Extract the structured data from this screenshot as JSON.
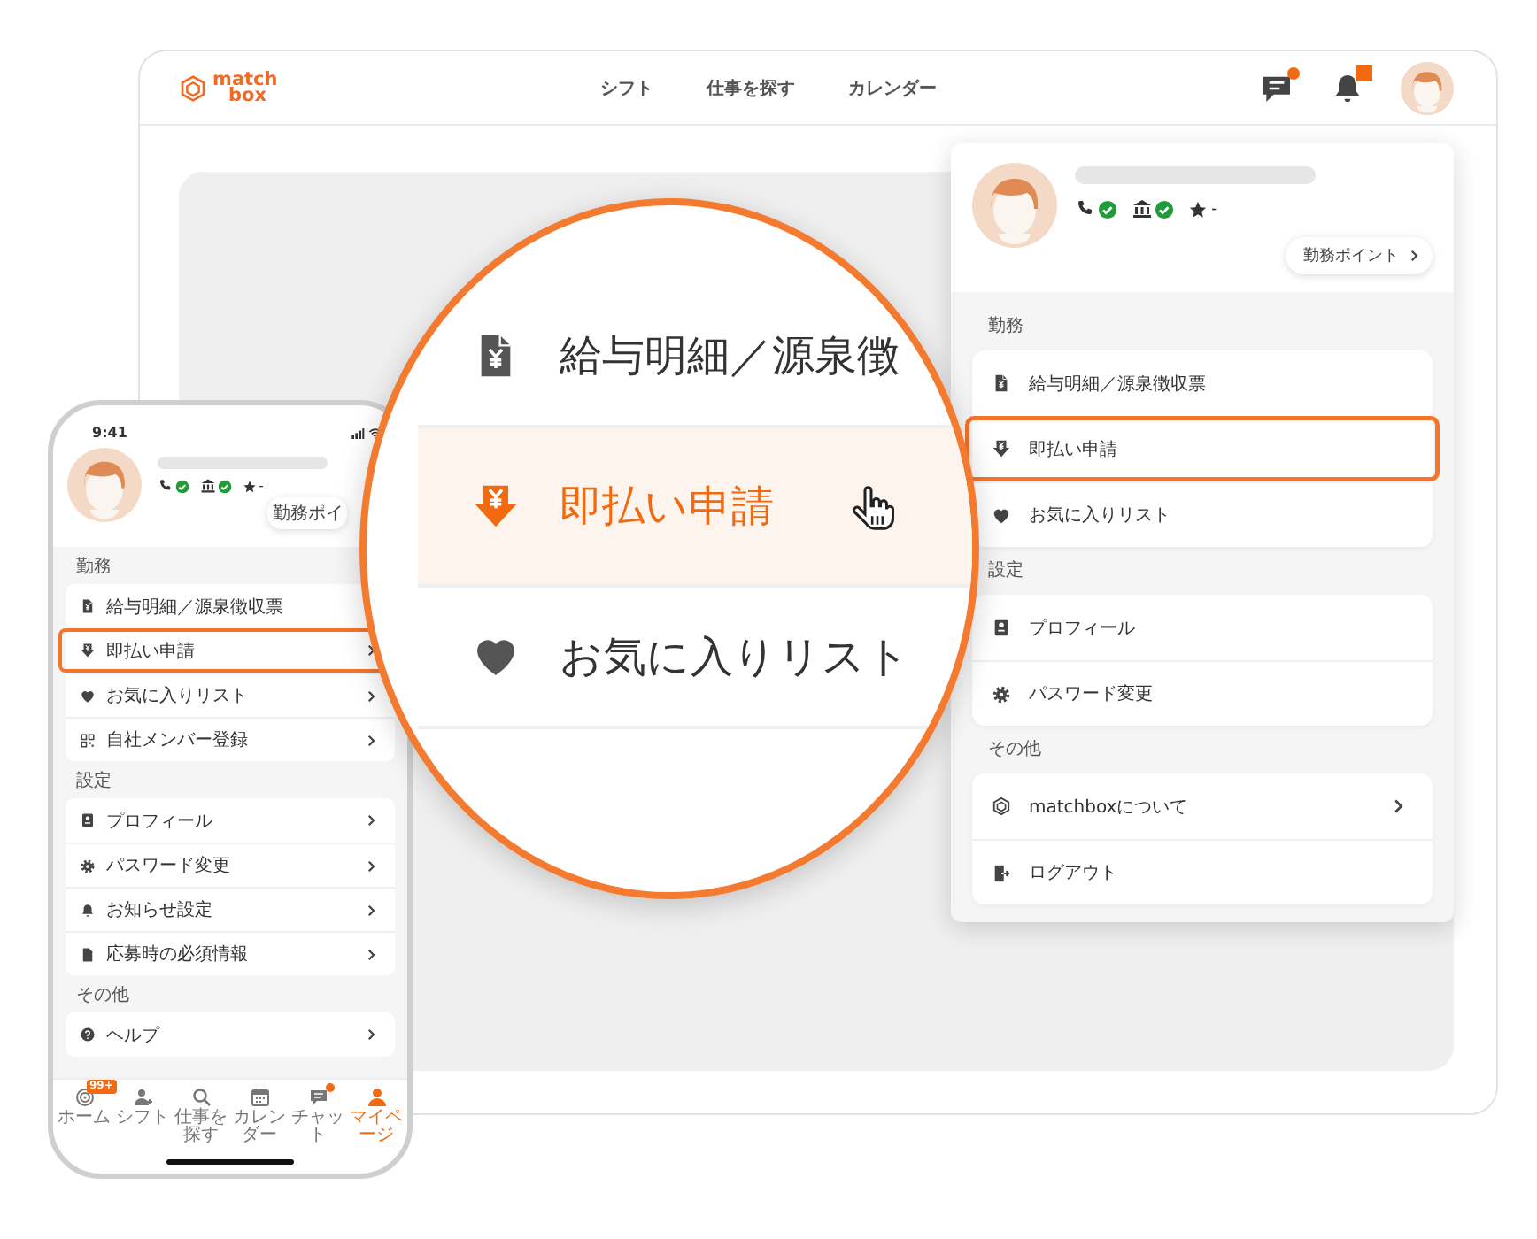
{
  "browser": {
    "logo": {
      "line_1": "match",
      "line_2": "box"
    },
    "nav": [
      {
        "label": "シフト"
      },
      {
        "label": "仕事を探す"
      },
      {
        "label": "カレンダー"
      }
    ],
    "chat_unread": true,
    "notifications_unread": true,
    "account_menu": {
      "checks": [
        {
          "kind": "phone",
          "verified": true
        },
        {
          "kind": "bank",
          "verified": true
        }
      ],
      "rating": "-",
      "points_button": "勤務ポイント",
      "sections": [
        {
          "title": "勤務",
          "items": [
            {
              "kind": "payslip",
              "label": "給与明細／源泉徴収票",
              "highlighted": false,
              "chevron": false
            },
            {
              "kind": "instant-pay",
              "label": "即払い申請",
              "highlighted": true,
              "chevron": false
            },
            {
              "kind": "heart",
              "label": "お気に入りリスト",
              "highlighted": false,
              "chevron": false
            }
          ]
        },
        {
          "title": "設定",
          "items": [
            {
              "kind": "profile",
              "label": "プロフィール",
              "highlighted": false,
              "chevron": false
            },
            {
              "kind": "gear",
              "label": "パスワード変更",
              "highlighted": false,
              "chevron": false
            }
          ]
        },
        {
          "title": "その他",
          "items": [
            {
              "kind": "hex",
              "label": "matchboxについて",
              "highlighted": false,
              "chevron": true
            },
            {
              "kind": "logout",
              "label": "ログアウト",
              "highlighted": false,
              "chevron": false
            }
          ]
        }
      ]
    }
  },
  "phone": {
    "time": "9:41",
    "checks": [
      {
        "kind": "phone",
        "verified": true
      },
      {
        "kind": "bank",
        "verified": true
      }
    ],
    "rating": "-",
    "points_button": "勤務ポイ",
    "sections": [
      {
        "title": "勤務",
        "items": [
          {
            "kind": "payslip",
            "label": "給与明細／源泉徴収票",
            "highlighted": false,
            "chevron": false
          },
          {
            "kind": "instant-pay",
            "label": "即払い申請",
            "highlighted": true,
            "chevron": true
          },
          {
            "kind": "heart",
            "label": "お気に入りリスト",
            "highlighted": false,
            "chevron": true
          },
          {
            "kind": "qr",
            "label": "自社メンバー登録",
            "highlighted": false,
            "chevron": true
          }
        ]
      },
      {
        "title": "設定",
        "items": [
          {
            "kind": "profile",
            "label": "プロフィール",
            "highlighted": false,
            "chevron": true
          },
          {
            "kind": "gear",
            "label": "パスワード変更",
            "highlighted": false,
            "chevron": true
          },
          {
            "kind": "bell",
            "label": "お知らせ設定",
            "highlighted": false,
            "chevron": true
          },
          {
            "kind": "file",
            "label": "応募時の必須情報",
            "highlighted": false,
            "chevron": true
          }
        ]
      },
      {
        "title": "その他",
        "items": [
          {
            "kind": "help",
            "label": "ヘルプ",
            "highlighted": false,
            "chevron": true
          }
        ]
      }
    ],
    "tabs": [
      {
        "kind": "home",
        "label": "ホーム",
        "selected": false,
        "dot": false,
        "badge": "99+"
      },
      {
        "kind": "shift",
        "label": "シフト",
        "selected": false,
        "dot": false
      },
      {
        "kind": "search",
        "label": "仕事を探す",
        "selected": false,
        "dot": false
      },
      {
        "kind": "calendar",
        "label": "カレンダー",
        "selected": false,
        "dot": false
      },
      {
        "kind": "chat",
        "label": "チャット",
        "selected": false,
        "dot": true
      },
      {
        "kind": "person",
        "label": "マイページ",
        "selected": true,
        "dot": false
      }
    ]
  },
  "magnifier": {
    "items": [
      {
        "kind": "payslip",
        "label": "給与明細／源泉徴",
        "highlighted": false
      },
      {
        "kind": "instant-pay",
        "label": "即払い申請",
        "highlighted": true
      },
      {
        "kind": "heart",
        "label": "お気に入りリスト",
        "highlighted": false
      }
    ]
  }
}
